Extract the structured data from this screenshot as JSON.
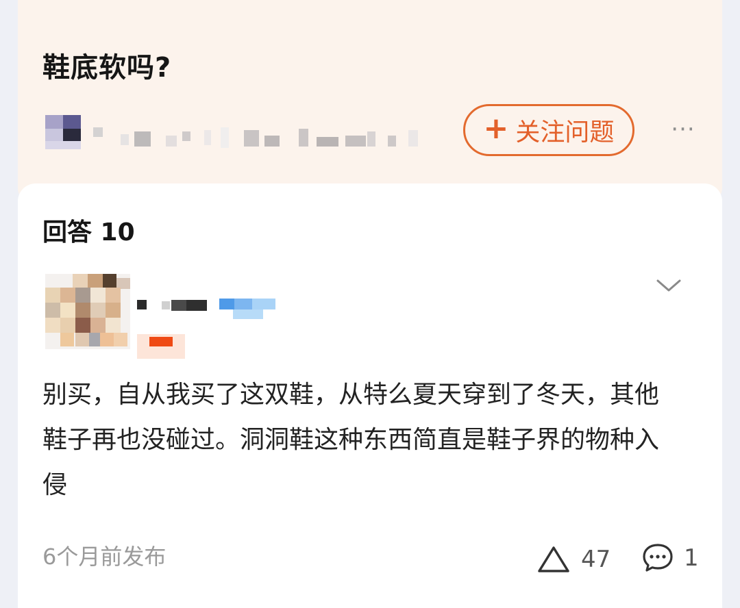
{
  "question": {
    "title": "鞋底软吗?",
    "follow_label": "关注问题",
    "follow_icon": "plus-icon",
    "more_icon": "more-horizontal-icon"
  },
  "answers": {
    "heading": "回答 10",
    "items": [
      {
        "body": "别买，自从我买了这双鞋，从特么夏天穿到了冬天，其他鞋子再也没碰过。洞洞鞋这种东西简直是鞋子界的物种入侵",
        "posted": "6个月前发布",
        "upvotes": "47",
        "comments": "1"
      }
    ]
  },
  "colors": {
    "accent": "#e3602a",
    "question_bg": "#fcf3ec",
    "card_bg": "#ffffff",
    "page_bg": "#eef0f6"
  }
}
